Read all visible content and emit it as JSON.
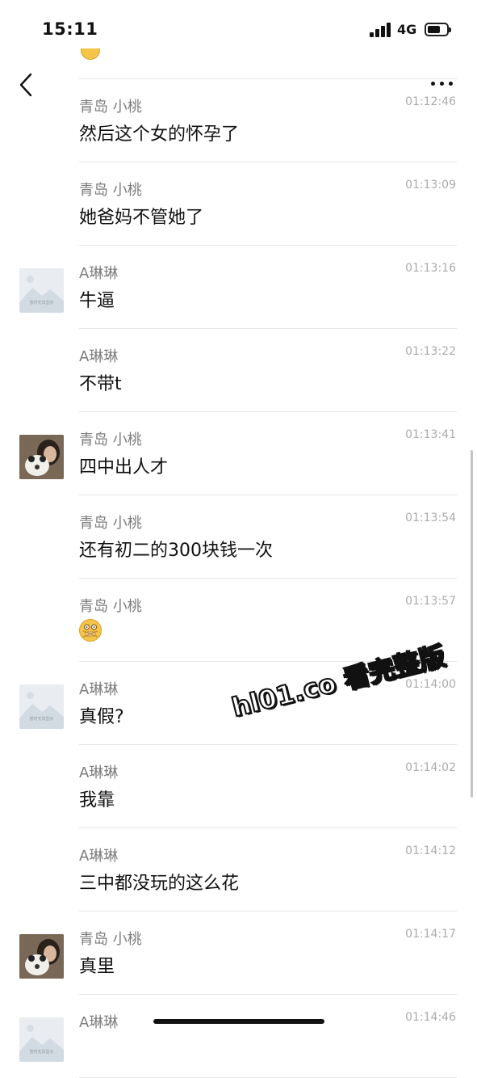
{
  "status_bar": {
    "time": "15:11",
    "network": "4G"
  },
  "colors": {
    "accent_text": "#111111",
    "sender": "#7d7d7d",
    "timestamp": "#ababab",
    "divider": "#e6e6e6"
  },
  "icons": {
    "back": "chevron-left-icon",
    "more": "more-dots-icon"
  },
  "placeholder_avatar_text": "暂时无法显示",
  "watermark": "hl01.co 看完整版",
  "messages": [
    {
      "sender": "青岛 小桃",
      "time": "01:12:46",
      "text": "然后这个女的怀孕了",
      "avatar": "none"
    },
    {
      "sender": "青岛 小桃",
      "time": "01:13:09",
      "text": "她爸妈不管她了",
      "avatar": "none"
    },
    {
      "sender": "A琳琳",
      "time": "01:13:16",
      "text": "牛逼",
      "avatar": "placeholder"
    },
    {
      "sender": "A琳琳",
      "time": "01:13:22",
      "text": "不带t",
      "avatar": "none"
    },
    {
      "sender": "青岛 小桃",
      "time": "01:13:41",
      "text": "四中出人才",
      "avatar": "photo"
    },
    {
      "sender": "青岛 小桃",
      "time": "01:13:54",
      "text": "还有初二的300块钱一次",
      "avatar": "none"
    },
    {
      "sender": "青岛 小桃",
      "time": "01:13:57",
      "text": "",
      "emoji": "shocked-emoji",
      "avatar": "none"
    },
    {
      "sender": "A琳琳",
      "time": "01:14:00",
      "text": "真假?",
      "avatar": "placeholder"
    },
    {
      "sender": "A琳琳",
      "time": "01:14:02",
      "text": "我靠",
      "avatar": "none"
    },
    {
      "sender": "A琳琳",
      "time": "01:14:12",
      "text": "三中都没玩的这么花",
      "avatar": "none"
    },
    {
      "sender": "青岛 小桃",
      "time": "01:14:17",
      "text": "真里",
      "avatar": "photo"
    },
    {
      "sender": "A琳琳",
      "time": "01:14:46",
      "text": "",
      "avatar": "placeholder"
    }
  ]
}
